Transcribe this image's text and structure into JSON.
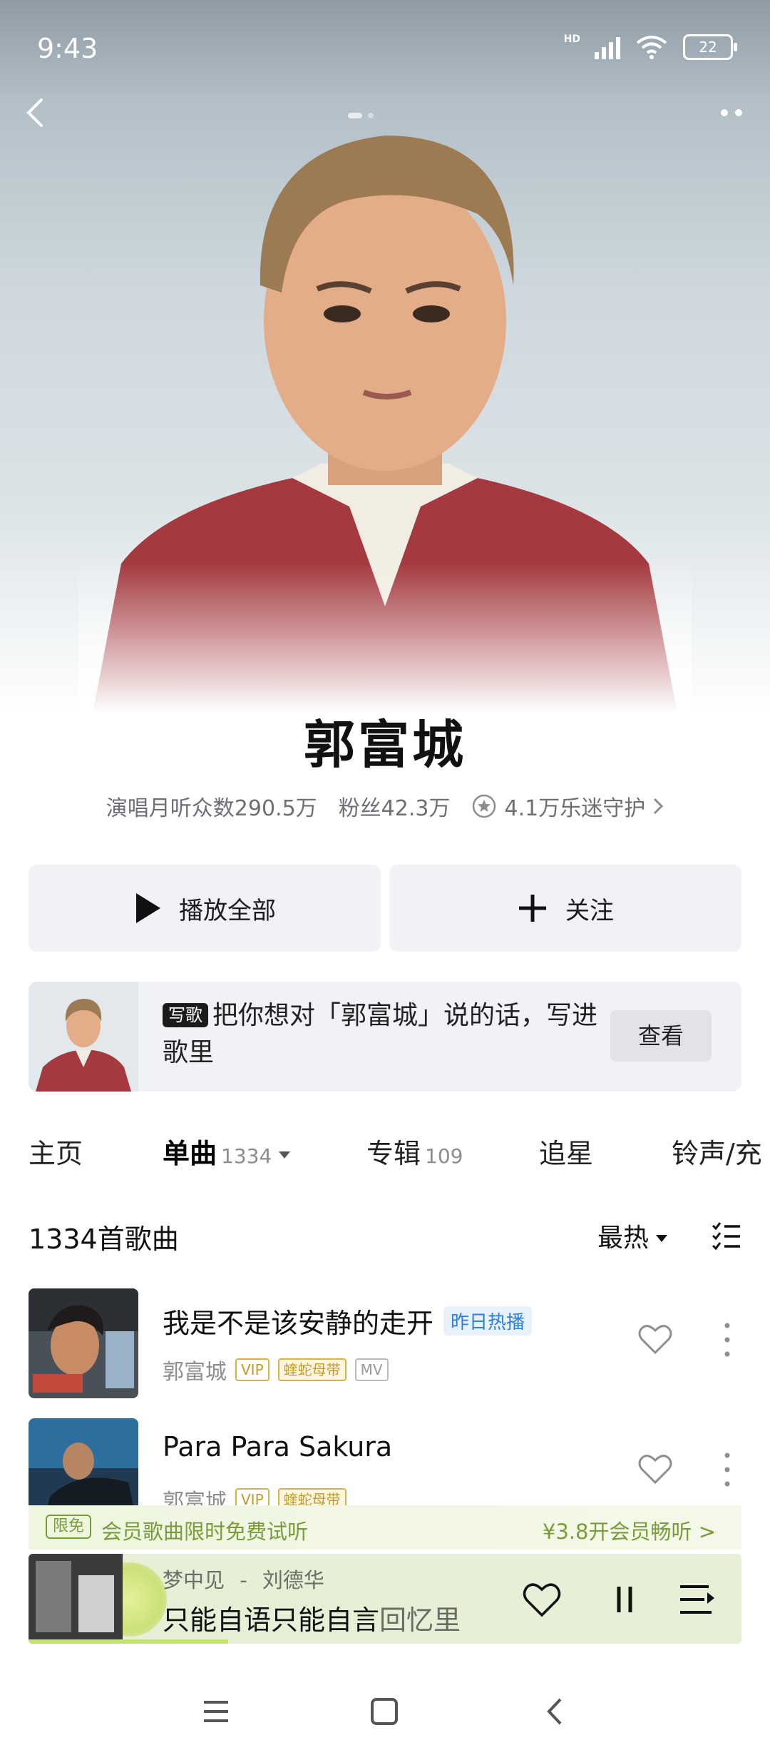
{
  "status_bar": {
    "time": "9:43",
    "network": "HD",
    "battery": "22"
  },
  "artist": {
    "name": "郭富城",
    "monthly_listeners": "演唱月听众数290.5万",
    "fans": "粉丝42.3万",
    "guardians": "4.1万乐迷守护"
  },
  "actions": {
    "play_all": "播放全部",
    "follow": "关注"
  },
  "promo": {
    "tag": "写歌",
    "text": "把你想对「郭富城」说的话，写进歌里",
    "button": "查看"
  },
  "tabs": [
    {
      "label": "主页",
      "count": ""
    },
    {
      "label": "单曲",
      "count": "1334"
    },
    {
      "label": "专辑",
      "count": "109"
    },
    {
      "label": "追星",
      "count": ""
    },
    {
      "label": "铃声/充",
      "count": ""
    }
  ],
  "song_list": {
    "heading": "1334首歌曲",
    "sort": "最热",
    "songs": [
      {
        "title": "我是不是该安静的走开",
        "tag": "昨日热播",
        "artist": "郭富城",
        "badges": [
          "VIP",
          "蝰蛇母带",
          "MV"
        ]
      },
      {
        "title": "Para Para Sakura",
        "tag": "",
        "artist": "郭富城",
        "badges": [
          "VIP",
          "蝰蛇母带"
        ]
      }
    ]
  },
  "vip_banner": {
    "label": "限免",
    "message": "会员歌曲限时免费试听",
    "cta": "¥3.8开会员畅听 >"
  },
  "player": {
    "song": "梦中见",
    "separator": "-",
    "artist": "刘德华",
    "lyric_main": "只能自语只能自言",
    "lyric_dim": "回忆里",
    "progress": 0.28
  },
  "colors": {
    "accent_green": "#c4e56b",
    "hot_blue": "#2f7fd6",
    "vip_gold": "#c39a2a"
  }
}
